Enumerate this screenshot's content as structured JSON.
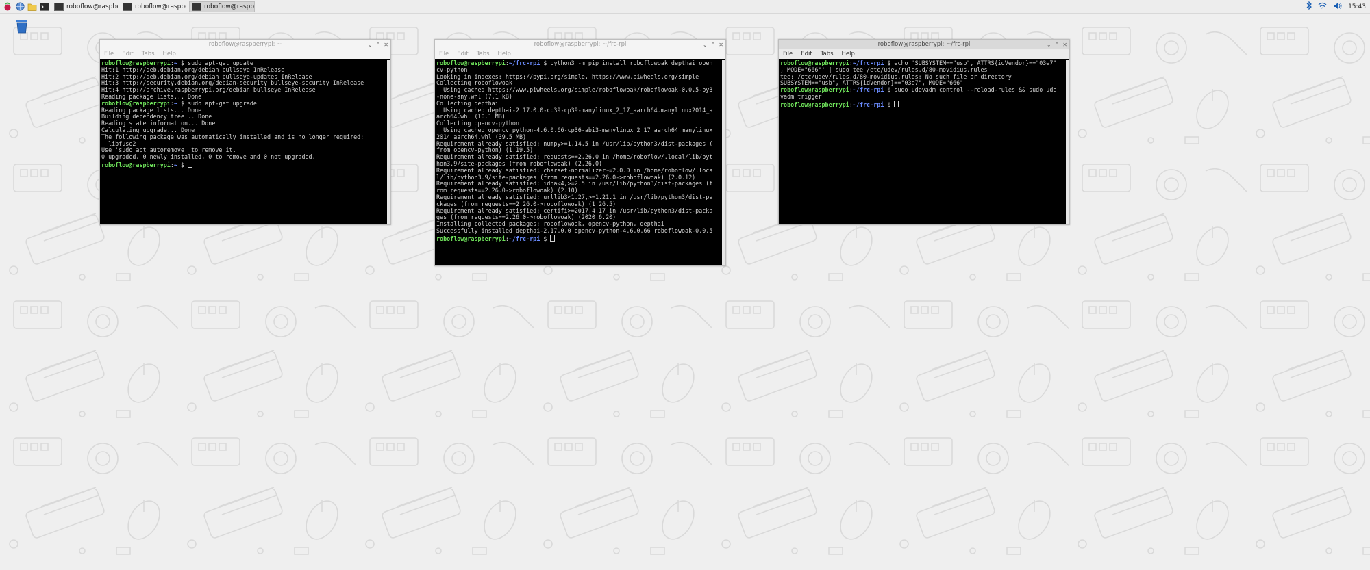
{
  "taskbar": {
    "tasks": [
      {
        "label": "roboflow@raspberry..."
      },
      {
        "label": "roboflow@raspberry..."
      },
      {
        "label": "roboflow@raspberry..."
      }
    ],
    "clock": "15:43"
  },
  "windows": [
    {
      "title": "roboflow@raspberrypi: ~",
      "menu": [
        "File",
        "Edit",
        "Tabs",
        "Help"
      ],
      "lines": [
        {
          "user": "roboflow@raspberrypi",
          "path": "~",
          "cmd": "sudo apt-get update"
        },
        {
          "text": "Hit:1 http://deb.debian.org/debian bullseye InRelease"
        },
        {
          "text": "Hit:2 http://deb.debian.org/debian bullseye-updates InRelease"
        },
        {
          "text": "Hit:3 http://security.debian.org/debian-security bullseye-security InRelease"
        },
        {
          "text": "Hit:4 http://archive.raspberrypi.org/debian bullseye InRelease"
        },
        {
          "text": "Reading package lists... Done"
        },
        {
          "user": "roboflow@raspberrypi",
          "path": "~",
          "cmd": "sudo apt-get upgrade"
        },
        {
          "text": "Reading package lists... Done"
        },
        {
          "text": "Building dependency tree... Done"
        },
        {
          "text": "Reading state information... Done"
        },
        {
          "text": "Calculating upgrade... Done"
        },
        {
          "text": "The following package was automatically installed and is no longer required:"
        },
        {
          "text": "  libfuse2"
        },
        {
          "text": "Use 'sudo apt autoremove' to remove it."
        },
        {
          "text": "0 upgraded, 0 newly installed, 0 to remove and 0 not upgraded."
        },
        {
          "user": "roboflow@raspberrypi",
          "path": "~",
          "cmd": "",
          "cursor": true
        }
      ]
    },
    {
      "title": "roboflow@raspberrypi: ~/frc-rpi",
      "menu": [
        "File",
        "Edit",
        "Tabs",
        "Help"
      ],
      "lines": [
        {
          "user": "roboflow@raspberrypi",
          "path": "~/frc-rpi",
          "cmd": "python3 -m pip install roboflowoak depthai open"
        },
        {
          "text": "cv-python"
        },
        {
          "text": "Looking in indexes: https://pypi.org/simple, https://www.piwheels.org/simple"
        },
        {
          "text": "Collecting roboflowoak"
        },
        {
          "text": "  Using cached https://www.piwheels.org/simple/roboflowoak/roboflowoak-0.0.5-py3"
        },
        {
          "text": "-none-any.whl (7.1 kB)"
        },
        {
          "text": "Collecting depthai"
        },
        {
          "text": "  Using cached depthai-2.17.0.0-cp39-cp39-manylinux_2_17_aarch64.manylinux2014_a"
        },
        {
          "text": "arch64.whl (10.1 MB)"
        },
        {
          "text": "Collecting opencv-python"
        },
        {
          "text": "  Using cached opencv_python-4.6.0.66-cp36-abi3-manylinux_2_17_aarch64.manylinux"
        },
        {
          "text": "2014_aarch64.whl (39.5 MB)"
        },
        {
          "text": "Requirement already satisfied: numpy>=1.14.5 in /usr/lib/python3/dist-packages ("
        },
        {
          "text": "from opencv-python) (1.19.5)"
        },
        {
          "text": "Requirement already satisfied: requests==2.26.0 in /home/roboflow/.local/lib/pyt"
        },
        {
          "text": "hon3.9/site-packages (from roboflowoak) (2.26.0)"
        },
        {
          "text": "Requirement already satisfied: charset-normalizer~=2.0.0 in /home/roboflow/.loca"
        },
        {
          "text": "l/lib/python3.9/site-packages (from requests==2.26.0->roboflowoak) (2.0.12)"
        },
        {
          "text": "Requirement already satisfied: idna<4,>=2.5 in /usr/lib/python3/dist-packages (f"
        },
        {
          "text": "rom requests==2.26.0->roboflowoak) (2.10)"
        },
        {
          "text": "Requirement already satisfied: urllib3<1.27,>=1.21.1 in /usr/lib/python3/dist-pa"
        },
        {
          "text": "ckages (from requests==2.26.0->roboflowoak) (1.26.5)"
        },
        {
          "text": "Requirement already satisfied: certifi>=2017.4.17 in /usr/lib/python3/dist-packa"
        },
        {
          "text": "ges (from requests==2.26.0->roboflowoak) (2020.6.20)"
        },
        {
          "text": "Installing collected packages: roboflowoak, opencv-python, depthai"
        },
        {
          "text": "Successfully installed depthai-2.17.0.0 opencv-python-4.6.0.66 roboflowoak-0.0.5"
        },
        {
          "user": "roboflow@raspberrypi",
          "path": "~/frc-rpi",
          "cmd": "",
          "cursor": true
        }
      ]
    },
    {
      "title": "roboflow@raspberrypi: ~/frc-rpi",
      "menu": [
        "File",
        "Edit",
        "Tabs",
        "Help"
      ],
      "lines": [
        {
          "user": "roboflow@raspberrypi",
          "path": "~/frc-rpi",
          "cmd": "echo 'SUBSYSTEM==\"usb\", ATTRS{idVendor}==\"03e7\""
        },
        {
          "text": ", MODE=\"666\"' | sudo tee /etc/udev/rules.d/80-movidius.rules"
        },
        {
          "text": "tee: /etc/udev/rules.d/80-movidius.rules: No such file or directory"
        },
        {
          "text": "SUBSYSTEM==\"usb\", ATTRS{idVendor}==\"03e7\", MODE=\"666\""
        },
        {
          "user": "roboflow@raspberrypi",
          "path": "~/frc-rpi",
          "cmd": "sudo udevadm control --reload-rules && sudo ude"
        },
        {
          "text": "vadm trigger"
        },
        {
          "user": "roboflow@raspberrypi",
          "path": "~/frc-rpi",
          "cmd": "",
          "cursor": true
        }
      ]
    }
  ]
}
